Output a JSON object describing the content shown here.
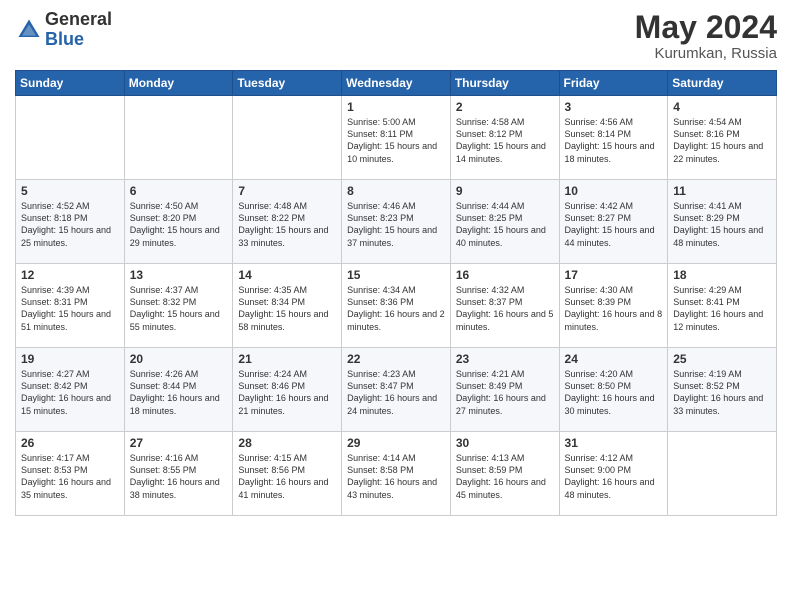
{
  "header": {
    "logo_general": "General",
    "logo_blue": "Blue",
    "month_year": "May 2024",
    "location": "Kurumkan, Russia"
  },
  "weekdays": [
    "Sunday",
    "Monday",
    "Tuesday",
    "Wednesday",
    "Thursday",
    "Friday",
    "Saturday"
  ],
  "weeks": [
    [
      {
        "day": "",
        "sunrise": "",
        "sunset": "",
        "daylight": ""
      },
      {
        "day": "",
        "sunrise": "",
        "sunset": "",
        "daylight": ""
      },
      {
        "day": "",
        "sunrise": "",
        "sunset": "",
        "daylight": ""
      },
      {
        "day": "1",
        "sunrise": "Sunrise: 5:00 AM",
        "sunset": "Sunset: 8:11 PM",
        "daylight": "Daylight: 15 hours and 10 minutes."
      },
      {
        "day": "2",
        "sunrise": "Sunrise: 4:58 AM",
        "sunset": "Sunset: 8:12 PM",
        "daylight": "Daylight: 15 hours and 14 minutes."
      },
      {
        "day": "3",
        "sunrise": "Sunrise: 4:56 AM",
        "sunset": "Sunset: 8:14 PM",
        "daylight": "Daylight: 15 hours and 18 minutes."
      },
      {
        "day": "4",
        "sunrise": "Sunrise: 4:54 AM",
        "sunset": "Sunset: 8:16 PM",
        "daylight": "Daylight: 15 hours and 22 minutes."
      }
    ],
    [
      {
        "day": "5",
        "sunrise": "Sunrise: 4:52 AM",
        "sunset": "Sunset: 8:18 PM",
        "daylight": "Daylight: 15 hours and 25 minutes."
      },
      {
        "day": "6",
        "sunrise": "Sunrise: 4:50 AM",
        "sunset": "Sunset: 8:20 PM",
        "daylight": "Daylight: 15 hours and 29 minutes."
      },
      {
        "day": "7",
        "sunrise": "Sunrise: 4:48 AM",
        "sunset": "Sunset: 8:22 PM",
        "daylight": "Daylight: 15 hours and 33 minutes."
      },
      {
        "day": "8",
        "sunrise": "Sunrise: 4:46 AM",
        "sunset": "Sunset: 8:23 PM",
        "daylight": "Daylight: 15 hours and 37 minutes."
      },
      {
        "day": "9",
        "sunrise": "Sunrise: 4:44 AM",
        "sunset": "Sunset: 8:25 PM",
        "daylight": "Daylight: 15 hours and 40 minutes."
      },
      {
        "day": "10",
        "sunrise": "Sunrise: 4:42 AM",
        "sunset": "Sunset: 8:27 PM",
        "daylight": "Daylight: 15 hours and 44 minutes."
      },
      {
        "day": "11",
        "sunrise": "Sunrise: 4:41 AM",
        "sunset": "Sunset: 8:29 PM",
        "daylight": "Daylight: 15 hours and 48 minutes."
      }
    ],
    [
      {
        "day": "12",
        "sunrise": "Sunrise: 4:39 AM",
        "sunset": "Sunset: 8:31 PM",
        "daylight": "Daylight: 15 hours and 51 minutes."
      },
      {
        "day": "13",
        "sunrise": "Sunrise: 4:37 AM",
        "sunset": "Sunset: 8:32 PM",
        "daylight": "Daylight: 15 hours and 55 minutes."
      },
      {
        "day": "14",
        "sunrise": "Sunrise: 4:35 AM",
        "sunset": "Sunset: 8:34 PM",
        "daylight": "Daylight: 15 hours and 58 minutes."
      },
      {
        "day": "15",
        "sunrise": "Sunrise: 4:34 AM",
        "sunset": "Sunset: 8:36 PM",
        "daylight": "Daylight: 16 hours and 2 minutes."
      },
      {
        "day": "16",
        "sunrise": "Sunrise: 4:32 AM",
        "sunset": "Sunset: 8:37 PM",
        "daylight": "Daylight: 16 hours and 5 minutes."
      },
      {
        "day": "17",
        "sunrise": "Sunrise: 4:30 AM",
        "sunset": "Sunset: 8:39 PM",
        "daylight": "Daylight: 16 hours and 8 minutes."
      },
      {
        "day": "18",
        "sunrise": "Sunrise: 4:29 AM",
        "sunset": "Sunset: 8:41 PM",
        "daylight": "Daylight: 16 hours and 12 minutes."
      }
    ],
    [
      {
        "day": "19",
        "sunrise": "Sunrise: 4:27 AM",
        "sunset": "Sunset: 8:42 PM",
        "daylight": "Daylight: 16 hours and 15 minutes."
      },
      {
        "day": "20",
        "sunrise": "Sunrise: 4:26 AM",
        "sunset": "Sunset: 8:44 PM",
        "daylight": "Daylight: 16 hours and 18 minutes."
      },
      {
        "day": "21",
        "sunrise": "Sunrise: 4:24 AM",
        "sunset": "Sunset: 8:46 PM",
        "daylight": "Daylight: 16 hours and 21 minutes."
      },
      {
        "day": "22",
        "sunrise": "Sunrise: 4:23 AM",
        "sunset": "Sunset: 8:47 PM",
        "daylight": "Daylight: 16 hours and 24 minutes."
      },
      {
        "day": "23",
        "sunrise": "Sunrise: 4:21 AM",
        "sunset": "Sunset: 8:49 PM",
        "daylight": "Daylight: 16 hours and 27 minutes."
      },
      {
        "day": "24",
        "sunrise": "Sunrise: 4:20 AM",
        "sunset": "Sunset: 8:50 PM",
        "daylight": "Daylight: 16 hours and 30 minutes."
      },
      {
        "day": "25",
        "sunrise": "Sunrise: 4:19 AM",
        "sunset": "Sunset: 8:52 PM",
        "daylight": "Daylight: 16 hours and 33 minutes."
      }
    ],
    [
      {
        "day": "26",
        "sunrise": "Sunrise: 4:17 AM",
        "sunset": "Sunset: 8:53 PM",
        "daylight": "Daylight: 16 hours and 35 minutes."
      },
      {
        "day": "27",
        "sunrise": "Sunrise: 4:16 AM",
        "sunset": "Sunset: 8:55 PM",
        "daylight": "Daylight: 16 hours and 38 minutes."
      },
      {
        "day": "28",
        "sunrise": "Sunrise: 4:15 AM",
        "sunset": "Sunset: 8:56 PM",
        "daylight": "Daylight: 16 hours and 41 minutes."
      },
      {
        "day": "29",
        "sunrise": "Sunrise: 4:14 AM",
        "sunset": "Sunset: 8:58 PM",
        "daylight": "Daylight: 16 hours and 43 minutes."
      },
      {
        "day": "30",
        "sunrise": "Sunrise: 4:13 AM",
        "sunset": "Sunset: 8:59 PM",
        "daylight": "Daylight: 16 hours and 45 minutes."
      },
      {
        "day": "31",
        "sunrise": "Sunrise: 4:12 AM",
        "sunset": "Sunset: 9:00 PM",
        "daylight": "Daylight: 16 hours and 48 minutes."
      },
      {
        "day": "",
        "sunrise": "",
        "sunset": "",
        "daylight": ""
      }
    ]
  ]
}
